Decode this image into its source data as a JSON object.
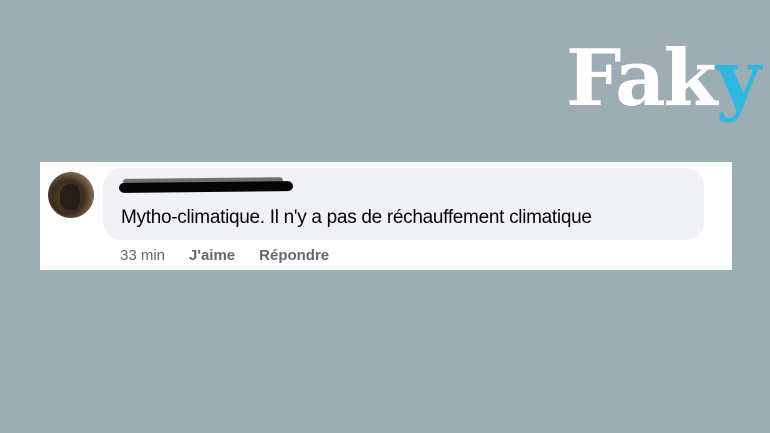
{
  "logo": {
    "text_main": "Fak",
    "text_accent": "y",
    "accent_color": "#2fb8e0"
  },
  "comment": {
    "author": "",
    "author_redacted": true,
    "text": "Mytho-climatique. Il n'y a pas de réchauffement climatique",
    "timestamp": "33 min",
    "like_label": "J'aime",
    "reply_label": "Répondre"
  },
  "colors": {
    "background": "#9caeb3",
    "bubble": "#f0f2f5",
    "meta_text": "#65676b"
  }
}
